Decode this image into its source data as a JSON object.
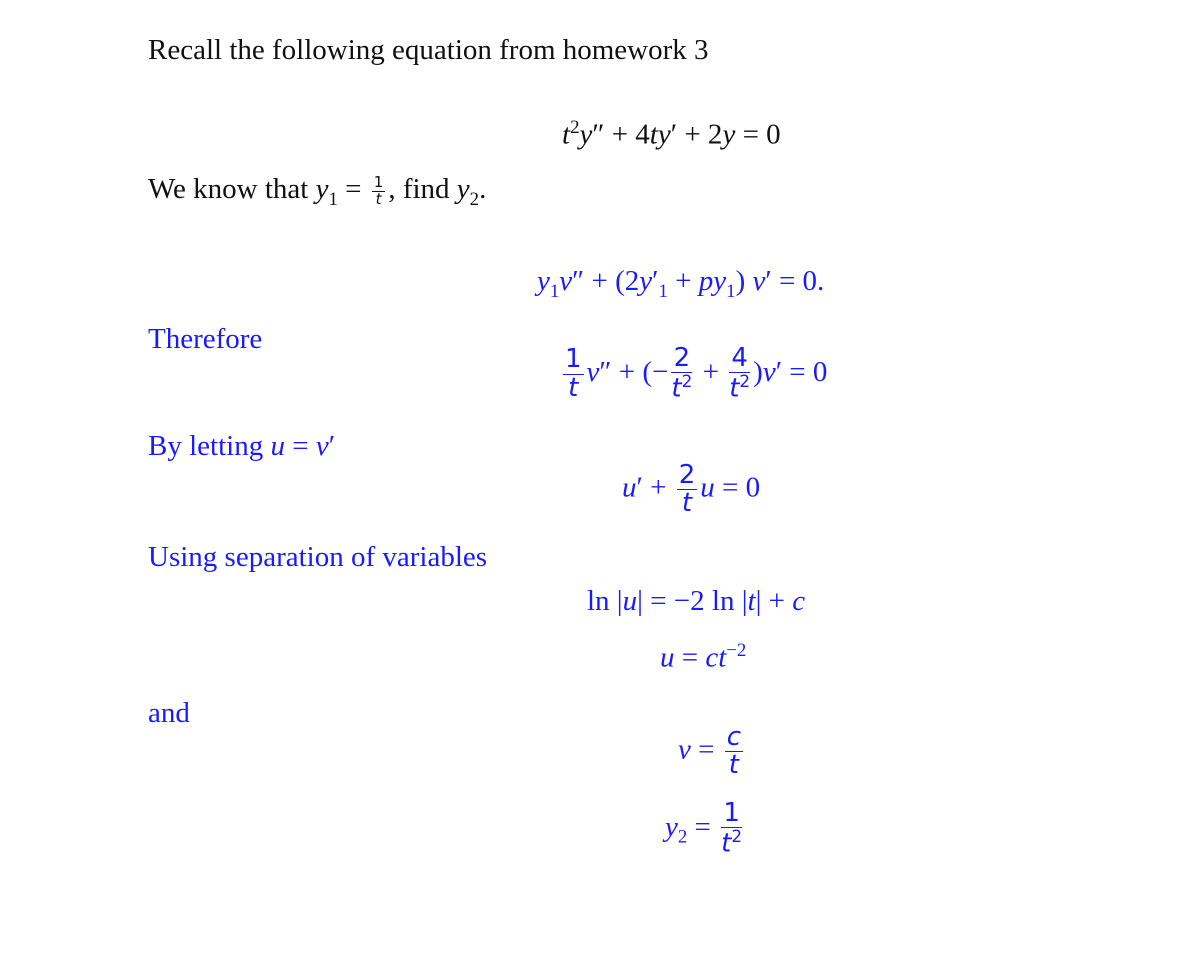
{
  "colors": {
    "text": "#111111",
    "accent": "#1a1aff"
  },
  "lines": {
    "intro": "Recall the following equation from homework 3",
    "equation_main": "t²y″ + 4ty′ + 2y = 0",
    "known_prefix": "We know that ",
    "known_y1": "y₁ = 1/t",
    "known_suffix": ", find y₂.",
    "reduction_formula": "y₁v″ + (2y′₁ + py₁) v′ = 0.",
    "therefore": "Therefore",
    "substituted": "(1/t)v″ + (−2/t² + 4/t²)v′ = 0",
    "letting_prefix": "By letting ",
    "letting_math": "u = v′",
    "first_order": "u′ + (2/t)u = 0",
    "separation": "Using separation of variables",
    "log_eq": "ln |u| = −2 ln |t| + c",
    "u_sol": "u = ct⁻²",
    "and": "and",
    "v_sol": "v = c/t",
    "y2_sol": "y₂ = 1/t²"
  }
}
